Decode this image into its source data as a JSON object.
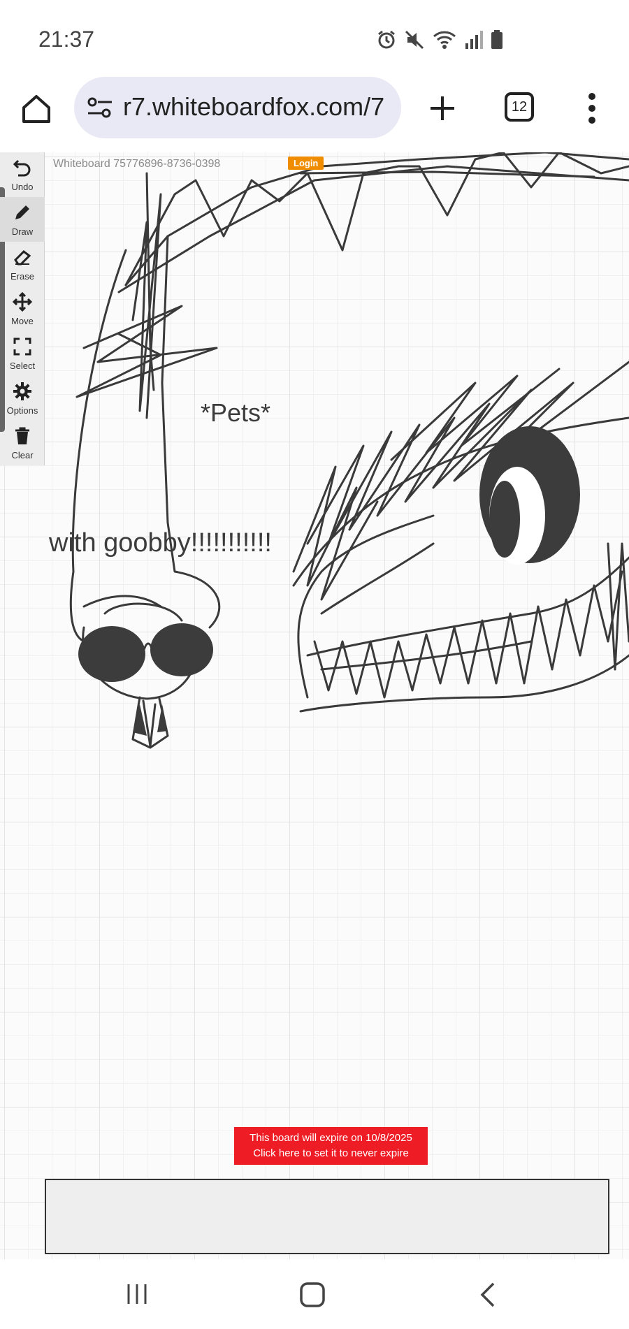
{
  "status_bar": {
    "time": "21:37",
    "icons": [
      "alarm-icon",
      "mute-icon",
      "wifi-icon",
      "signal-icon",
      "battery-icon"
    ]
  },
  "browser": {
    "url": "r7.whiteboardfox.com/7",
    "tab_count": "12",
    "icons": [
      "home-icon",
      "site-settings-icon",
      "plus-icon",
      "tabs-icon",
      "more-vert-icon"
    ]
  },
  "whiteboard": {
    "title": "Whiteboard 75776896-8736-0398",
    "login_label": "Login",
    "texts": {
      "pets": "*Pets*",
      "goobby": "with goobby!!!!!!!!!!!"
    },
    "stroke_color": "#3a3a3a"
  },
  "tools": [
    {
      "label": "Undo",
      "icon": "undo-icon"
    },
    {
      "label": "Draw",
      "icon": "pencil-icon"
    },
    {
      "label": "Erase",
      "icon": "eraser-icon"
    },
    {
      "label": "Move",
      "icon": "move-icon"
    },
    {
      "label": "Select",
      "icon": "select-icon"
    },
    {
      "label": "Options",
      "icon": "gear-icon"
    },
    {
      "label": "Clear",
      "icon": "trash-icon"
    }
  ],
  "expire_banner": {
    "line1": "This board will expire on 10/8/2025",
    "line2": "Click here to set it to never expire",
    "color": "#ee1c24"
  },
  "nav_bar": {
    "icons": [
      "recent-apps-icon",
      "home-nav-icon",
      "back-icon"
    ]
  }
}
